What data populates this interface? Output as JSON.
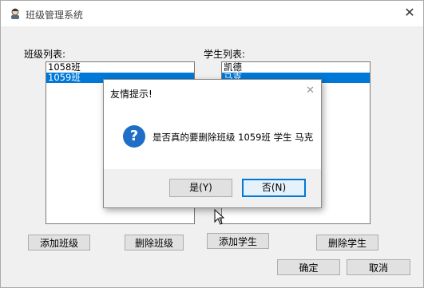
{
  "window": {
    "title": "班级管理系统"
  },
  "classes": {
    "label": "班级列表:",
    "items": [
      "1058班",
      "1059班"
    ],
    "selected": 1
  },
  "students": {
    "label": "学生列表:",
    "items": [
      "凯德",
      "马克"
    ],
    "selected": 1
  },
  "buttons": {
    "add_class": "添加班级",
    "delete_class": "删除班级",
    "add_student": "添加学生",
    "delete_student": "删除学生",
    "ok": "确定",
    "cancel": "取消"
  },
  "dialog": {
    "title": "友情提示!",
    "message": "是否真的要删除班级 1059班 学生 马克",
    "yes": "是(Y)",
    "no": "否(N)",
    "icon": "question-icon"
  },
  "colors": {
    "selection": "#0078d7",
    "accent_focus": "#0078d7"
  }
}
